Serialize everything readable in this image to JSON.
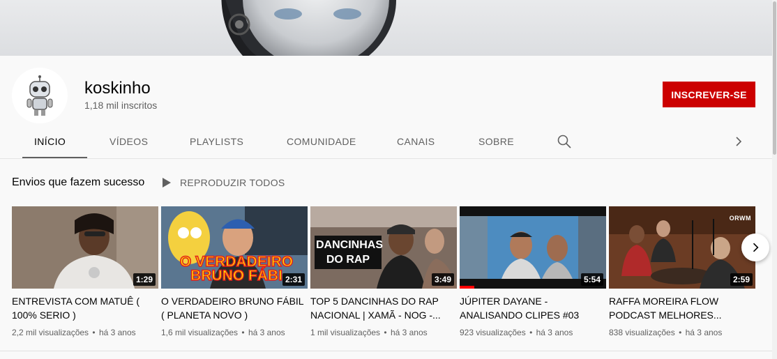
{
  "channel": {
    "name": "koskinho",
    "subscribers": "1,18 mil inscritos",
    "subscribe_label": "INSCREVER-SE"
  },
  "tabs": [
    {
      "label": "INÍCIO",
      "active": true
    },
    {
      "label": "VÍDEOS"
    },
    {
      "label": "PLAYLISTS"
    },
    {
      "label": "COMUNIDADE"
    },
    {
      "label": "CANAIS"
    },
    {
      "label": "SOBRE"
    }
  ],
  "icons": {
    "search": "search-icon",
    "tabs_next": "chevron-right-icon",
    "play": "play-icon",
    "shelf_next": "chevron-right-icon"
  },
  "shelf": {
    "title": "Envios que fazem sucesso",
    "play_all": "REPRODUZIR TODOS"
  },
  "videos": [
    {
      "title": "ENTREVISTA COM MATUÊ ( 100% SERIO )",
      "duration": "1:29",
      "views": "2,2 mil visualizações",
      "age": "há 3 anos",
      "thumb_text": ""
    },
    {
      "title": "O VERDADEIRO BRUNO FÁBIL ( PLANETA NOVO )",
      "duration": "2:31",
      "views": "1,6 mil visualizações",
      "age": "há 3 anos",
      "thumb_text": "O VERDADEIRO BRUNO FÁBI"
    },
    {
      "title": "TOP 5 DANCINHAS DO RAP NACIONAL | XAMÃ - NOG -...",
      "duration": "3:49",
      "views": "1 mil visualizações",
      "age": "há 3 anos",
      "thumb_text": "DANCINHAS DO RAP"
    },
    {
      "title": "JÚPITER DAYANE - ANALISANDO CLIPES #03",
      "duration": "5:54",
      "views": "923 visualizações",
      "age": "há 3 anos",
      "thumb_text": "",
      "watched_fraction": 0.1
    },
    {
      "title": "RAFFA MOREIRA FLOW PODCAST MELHORES...",
      "duration": "2:59",
      "views": "838 visualizações",
      "age": "há 3 anos",
      "thumb_text": "ORWM"
    }
  ],
  "meta_separator": "•",
  "colors": {
    "subscribe_bg": "#cc0000",
    "progress": "#ff0000",
    "thumb_title_yellow": "#ffde00",
    "thumb_title_red": "#e31d1d"
  }
}
